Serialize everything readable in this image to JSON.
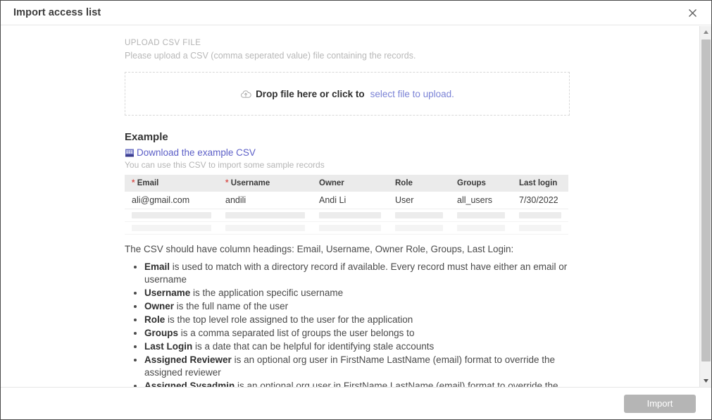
{
  "dialog": {
    "title": "Import access list",
    "close_icon": "close-icon"
  },
  "upload": {
    "section_label": "UPLOAD CSV FILE",
    "description": "Please upload a CSV (comma seperated value) file containing the records.",
    "dropzone_icon": "cloud-upload-icon",
    "dropzone_text": "Drop file here or click to",
    "dropzone_link": "select file to upload.",
    "link_color": "#7b83d6"
  },
  "example": {
    "heading": "Example",
    "download_icon": "spreadsheet-icon",
    "download_link": "Download the example CSV",
    "download_link_color": "#5c5fc7",
    "subtitle": "You can use this CSV to import some sample records",
    "table": {
      "columns": [
        {
          "label": "Email",
          "required": true
        },
        {
          "label": "Username",
          "required": true
        },
        {
          "label": "Owner",
          "required": false
        },
        {
          "label": "Role",
          "required": false
        },
        {
          "label": "Groups",
          "required": false
        },
        {
          "label": "Last login",
          "required": false
        }
      ],
      "required_marker": "*",
      "required_marker_color": "#d9534f",
      "rows": [
        [
          "ali@gmail.com",
          "andili",
          "Andi Li",
          "User",
          "all_users",
          "7/30/2022"
        ]
      ],
      "placeholder_row_count": 2
    }
  },
  "instructions": {
    "intro": "The CSV should have column headings: Email, Username, Owner Role, Groups, Last Login:",
    "items": [
      {
        "term": "Email",
        "desc": " is used to match with a directory record if available. Every record must have either an email or username"
      },
      {
        "term": "Username",
        "desc": " is the application specific username"
      },
      {
        "term": "Owner",
        "desc": " is the full name of the user"
      },
      {
        "term": "Role",
        "desc": " is the top level role assigned to the user for the application"
      },
      {
        "term": "Groups",
        "desc": " is a comma separated list of groups the user belongs to"
      },
      {
        "term": "Last Login",
        "desc": " is a date that can be helpful for identifying stale accounts"
      },
      {
        "term": "Assigned Reviewer",
        "desc": " is an optional org user in FirstName LastName (email) format to override the assigned reviewer"
      },
      {
        "term": "Assigned Sysadmin",
        "desc": " is an optional org user in FirstName LastName (email) format to override the assigned sysadmin"
      }
    ]
  },
  "footer": {
    "import_label": "Import",
    "import_enabled": false,
    "import_color": "#b5b5b5"
  },
  "scrollbar": {
    "up_icon": "caret-up-icon",
    "down_icon": "caret-down-icon",
    "thumb_color": "#c1c1c1"
  }
}
